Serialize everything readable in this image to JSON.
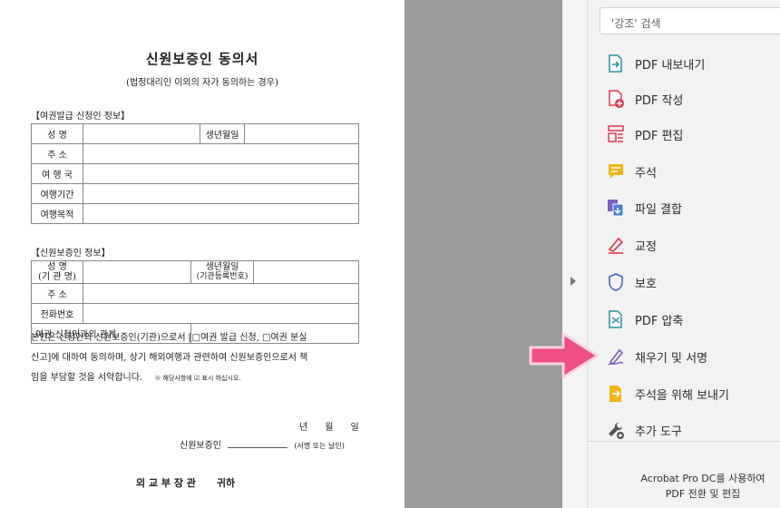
{
  "document": {
    "title": "신원보증인 동의서",
    "subtitle": "(법정대리인 이외의 자가 동의하는 경우)",
    "applicant_section": "【여권발급 신청인 정보】",
    "applicant_rows": [
      "성      명",
      "주      소",
      "여 행 국",
      "여행기간",
      "여행목적"
    ],
    "applicant_dob": "생년월일",
    "guarantor_section": "【신원보증인 정보】",
    "guarantor_name_label": "성      명",
    "guarantor_name_sub": "(기 관 명)",
    "guarantor_dob_label": "생년월일",
    "guarantor_dob_sub": "(기관등록번호)",
    "guarantor_address": "주      소",
    "guarantor_phone": "전화번호",
    "guarantor_relation": "여권 신청인과의 관계",
    "body_line1": "본인은 신청인의 신원보증인(기관)으로서 [□여권 발급 신청, □여권 분실",
    "body_line2": "신고]에 대하여 동의하며, 상기 해외여행과 관련하여 신원보증인으로서 책",
    "body_line3": "임을 부담할 것을 서약합니다.",
    "body_note": "※ 해당사항에 ☑ 표시 하십시오.",
    "date_line": "년      월      일",
    "signer_label": "신원보증인",
    "signer_suffix": "(서명 또는 날인)",
    "addressee": "외 교 부 장 관      귀하"
  },
  "panel": {
    "search_placeholder": "'강조' 검색",
    "tools": [
      {
        "label": "PDF 내보내기",
        "icon": "export-pdf-icon"
      },
      {
        "label": "PDF 작성",
        "icon": "create-pdf-icon"
      },
      {
        "label": "PDF 편집",
        "icon": "edit-pdf-icon"
      },
      {
        "label": "주석",
        "icon": "comment-icon"
      },
      {
        "label": "파일 결합",
        "icon": "combine-files-icon"
      },
      {
        "label": "교정",
        "icon": "redact-icon"
      },
      {
        "label": "보호",
        "icon": "protect-icon"
      },
      {
        "label": "PDF 압축",
        "icon": "compress-pdf-icon"
      },
      {
        "label": "채우기 및 서명",
        "icon": "fill-sign-icon"
      },
      {
        "label": "주석을 위해 보내기",
        "icon": "send-for-comments-icon"
      },
      {
        "label": "추가 도구",
        "icon": "more-tools-icon"
      }
    ],
    "promo_line1": "Acrobat Pro DC를 사용하여",
    "promo_line2": "PDF 전환 및 편집"
  },
  "colors": {
    "accent_teal": "#2a8fa3",
    "accent_red": "#e2364b",
    "accent_yellow": "#f1b515",
    "accent_purple": "#7a5fc4",
    "pointer_pink": "#ef4f87"
  }
}
